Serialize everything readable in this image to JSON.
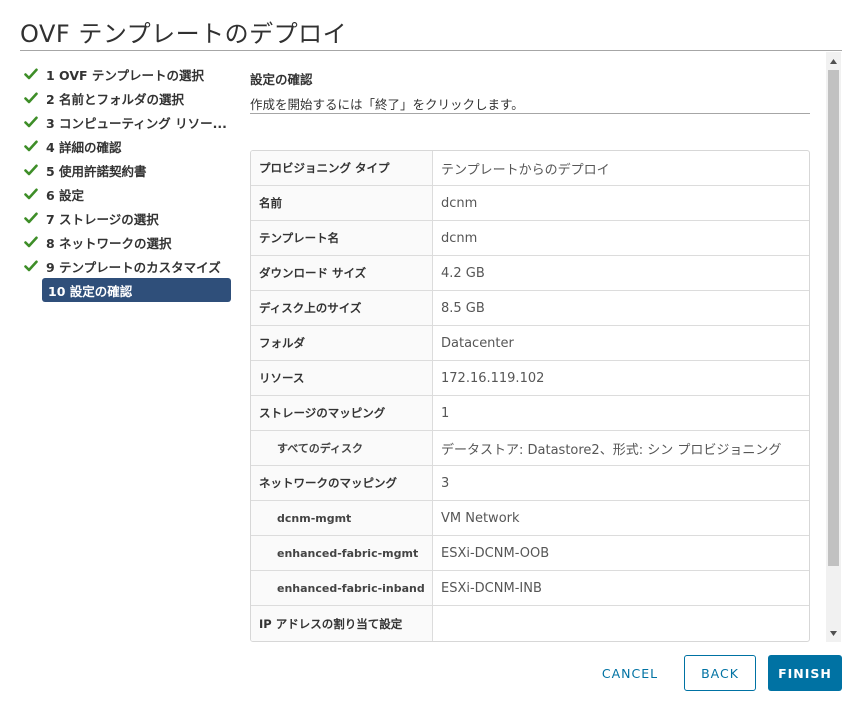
{
  "dialog": {
    "title": "OVF テンプレートのデプロイ"
  },
  "steps": [
    {
      "label": "1 OVF テンプレートの選択",
      "done": true
    },
    {
      "label": "2 名前とフォルダの選択",
      "done": true
    },
    {
      "label": "3 コンピューティング リソー...",
      "done": true
    },
    {
      "label": "4 詳細の確認",
      "done": true
    },
    {
      "label": "5 使用許諾契約書",
      "done": true
    },
    {
      "label": "6 設定",
      "done": true
    },
    {
      "label": "7 ストレージの選択",
      "done": true
    },
    {
      "label": "8 ネットワークの選択",
      "done": true
    },
    {
      "label": "9 テンプレートのカスタマイズ",
      "done": true
    },
    {
      "label": "10 設定の確認",
      "active": true
    }
  ],
  "content": {
    "title": "設定の確認",
    "subtitle": "作成を開始するには「終了」をクリックします。"
  },
  "table": {
    "rows": [
      {
        "label": "プロビジョニング タイプ",
        "value": "テンプレートからのデプロイ"
      },
      {
        "label": "名前",
        "value": "dcnm"
      },
      {
        "label": "テンプレート名",
        "value": "dcnm"
      },
      {
        "label": "ダウンロード サイズ",
        "value": "4.2 GB"
      },
      {
        "label": "ディスク上のサイズ",
        "value": "8.5 GB"
      },
      {
        "label": "フォルダ",
        "value": "Datacenter"
      },
      {
        "label": "リソース",
        "value": "172.16.119.102"
      },
      {
        "label": "ストレージのマッピング",
        "value": "1"
      },
      {
        "label": "すべてのディスク",
        "value": "データストア: Datastore2、形式: シン プロビジョニング"
      },
      {
        "label": "ネットワークのマッピング",
        "value": "3"
      },
      {
        "label": "dcnm-mgmt",
        "value": "VM Network"
      },
      {
        "label": "enhanced-fabric-mgmt",
        "value": "ESXi-DCNM-OOB"
      },
      {
        "label": "enhanced-fabric-inband",
        "value": "ESXi-DCNM-INB"
      },
      {
        "label": "IP アドレスの割り当て設定",
        "value": ""
      }
    ]
  },
  "buttons": {
    "cancel": "CANCEL",
    "back": "BACK",
    "finish": "FINISH"
  },
  "colors": {
    "check": "#3e8e28",
    "active_step_bg": "#2f4f7a",
    "primary": "#0072a3"
  },
  "icons": {
    "step_done": "checkmark-icon",
    "scroll_up": "arrow-up-icon",
    "scroll_down": "arrow-down-icon"
  }
}
